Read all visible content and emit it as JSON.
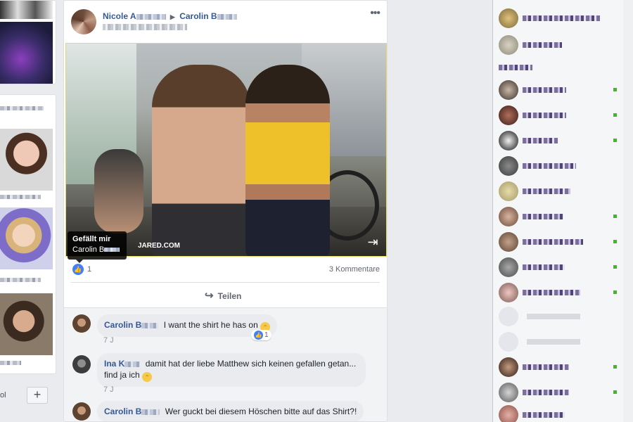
{
  "post": {
    "author": "Nicole A",
    "target": "Carolin B",
    "photo_credit": "JARED.COM",
    "tooltip": {
      "title": "Gefällt mir",
      "name": "Carolin B"
    },
    "likes": "1",
    "comments_count": "3 Kommentare",
    "share_label": "Teilen"
  },
  "comments": [
    {
      "name": "Carolin B",
      "text": "I want the shirt he has on",
      "time": "7 J",
      "likes": "1"
    },
    {
      "name": "Ina K",
      "text": "damit hat der liebe Matthew sich keinen gefallen getan... find ja ich",
      "time": "7 J"
    },
    {
      "name": "Carolin B",
      "text": "Wer guckt bei diesem Höschen bitte auf das Shirt?!"
    }
  ],
  "left_col": {
    "bottom_text": "ol",
    "add_label": "+"
  },
  "colors": {
    "link": "#365899",
    "like_blue": "#4080ff",
    "online": "#42b72a",
    "background": "#e9ebee"
  },
  "icons": [
    "more-options-icon",
    "expand-icon",
    "like-icon",
    "share-icon",
    "smile-emoji-icon",
    "online-dot-icon"
  ]
}
